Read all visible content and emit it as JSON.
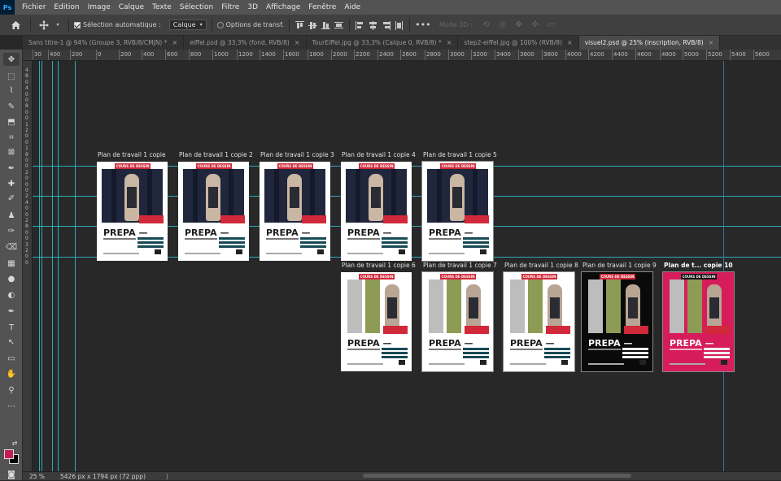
{
  "menubar": {
    "logo": "Ps",
    "items": [
      "Fichier",
      "Edition",
      "Image",
      "Calque",
      "Texte",
      "Sélection",
      "Filtre",
      "3D",
      "Affichage",
      "Fenêtre",
      "Aide"
    ]
  },
  "options": {
    "auto_select_label": "Sélection automatique :",
    "auto_select_checked": true,
    "layer_select": "Calque",
    "transform_label": "Options de transf.",
    "mode_3d": "Mode 3D :"
  },
  "tabs": [
    {
      "label": "Sans titre-1 @ 94% (Groupe 3, RVB/8/CMJN) *",
      "active": false
    },
    {
      "label": "eiffel.psd @ 33,3% (fond, RVB/8)",
      "active": false
    },
    {
      "label": "TourEiffel.jpg @ 33,3% (Calque 0, RVB/8) *",
      "active": false
    },
    {
      "label": "step2-eiffel.jpg @ 100% (RVB/8)",
      "active": false
    },
    {
      "label": "visuel2.psd @ 25% (inscription, RVB/8)",
      "active": true
    }
  ],
  "tabs_close_glyph": "×",
  "ruler_top_labels": [
    "30",
    "400",
    "200",
    "0",
    "200",
    "400",
    "600",
    "800",
    "1000",
    "1200",
    "1400",
    "1600",
    "1800",
    "2000",
    "2200",
    "2400",
    "2600",
    "2800",
    "3000",
    "3200",
    "3400",
    "3600",
    "3800",
    "4000",
    "4200",
    "4400",
    "4600",
    "4800",
    "5000",
    "5200",
    "5400",
    "5600"
  ],
  "ruler_left_labels": [
    "4",
    "8",
    "0",
    "4",
    "0",
    "0",
    "8",
    "0",
    "0",
    "1",
    "2",
    "0",
    "0",
    "1",
    "8",
    "0",
    "0",
    "2",
    "0",
    "0",
    "0",
    "2",
    "4",
    "0",
    "0",
    "2",
    "8",
    "0",
    "0",
    "3",
    "2",
    "0",
    "0"
  ],
  "artboards": [
    {
      "label": "Plan de travail 1 copie",
      "theme": "white",
      "art": "hero"
    },
    {
      "label": "Plan de travail 1 copie 2",
      "theme": "white",
      "art": "hero"
    },
    {
      "label": "Plan de travail 1 copie 3",
      "theme": "white",
      "art": "hero"
    },
    {
      "label": "Plan de travail 1 copie 4",
      "theme": "white",
      "art": "hero"
    },
    {
      "label": "Plan de travail 1 copie 5",
      "theme": "white",
      "art": "hero"
    },
    {
      "label": "Plan de travail 1 copie 6",
      "theme": "white",
      "art": "sketch"
    },
    {
      "label": "Plan de travail 1 copie 7",
      "theme": "white",
      "art": "sketch"
    },
    {
      "label": "Plan de travail 1 copie 8",
      "theme": "white",
      "art": "sketch"
    },
    {
      "label": "Plan de travail 1 copie 9",
      "theme": "black",
      "art": "sketch"
    },
    {
      "label": "Plan de t... copie 10",
      "theme": "pink",
      "art": "sketch"
    }
  ],
  "poster": {
    "banner": "COURS DE DESSIN",
    "title": "PREPA —"
  },
  "status": {
    "zoom": "25 %",
    "dimensions": "5426 px x 1794 px (72 ppp)",
    "arrow": ")"
  },
  "colors": {
    "foreground": "#c31f53",
    "background": "#000000",
    "guide": "#2fc3d3",
    "banner": "#d1283a"
  },
  "tools": [
    "move-tool",
    "artboard-tool",
    "marquee-tool",
    "lasso-tool",
    "quick-select-tool",
    "crop-tool",
    "frame-tool",
    "eyedropper-tool",
    "healing-brush-tool",
    "brush-tool",
    "clone-stamp-tool",
    "history-brush-tool",
    "eraser-tool",
    "gradient-tool",
    "blur-tool",
    "dodge-tool",
    "pen-tool",
    "type-tool",
    "path-select-tool",
    "shape-tool",
    "hand-tool",
    "zoom-tool",
    "more-tools"
  ]
}
